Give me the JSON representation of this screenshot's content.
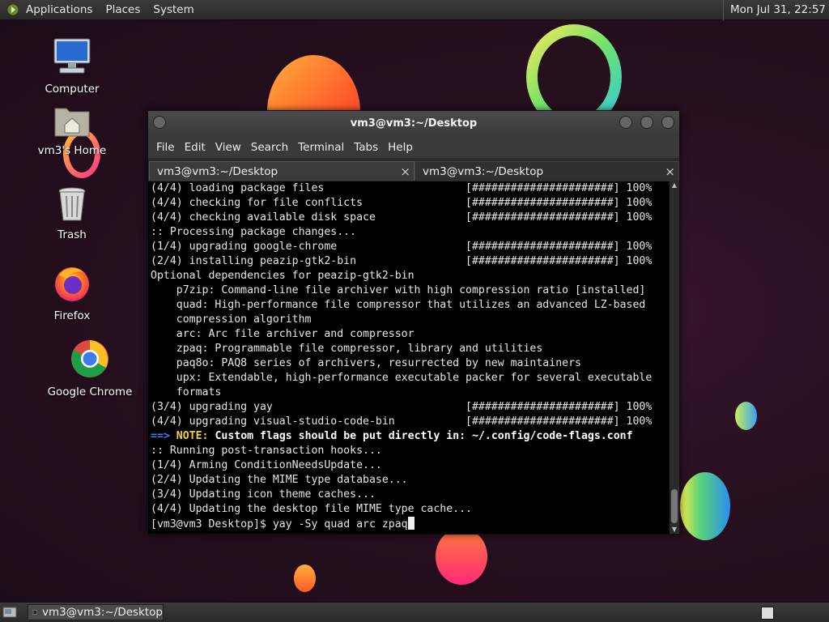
{
  "top_panel": {
    "menus": [
      "Applications",
      "Places",
      "System"
    ],
    "clock": "Mon Jul 31, 22:57"
  },
  "desktop_icons": [
    {
      "label": "Computer",
      "icon": "computer-icon"
    },
    {
      "label": "vm3's Home",
      "icon": "home-folder-icon"
    },
    {
      "label": "Trash",
      "icon": "trash-icon"
    },
    {
      "label": "Firefox",
      "icon": "firefox-icon"
    },
    {
      "label": "Google Chrome",
      "icon": "chrome-icon"
    }
  ],
  "window": {
    "title": "vm3@vm3:~/Desktop",
    "menu": [
      "File",
      "Edit",
      "View",
      "Search",
      "Terminal",
      "Tabs",
      "Help"
    ],
    "tabs": [
      {
        "label": "vm3@vm3:~/Desktop",
        "close": "×"
      },
      {
        "label": "vm3@vm3:~/Desktop",
        "close": "×"
      }
    ]
  },
  "terminal": {
    "lines": [
      "(4/4) loading package files                      [######################] 100%",
      "(4/4) checking for file conflicts                [######################] 100%",
      "(4/4) checking available disk space              [######################] 100%",
      ":: Processing package changes...",
      "(1/4) upgrading google-chrome                    [######################] 100%",
      "(2/4) installing peazip-gtk2-bin                 [######################] 100%",
      "Optional dependencies for peazip-gtk2-bin",
      "    p7zip: Command-line file archiver with high compression ratio [installed]",
      "    quad: High-performance file compressor that utilizes an advanced LZ-based",
      "    compression algorithm",
      "    arc: Arc file archiver and compressor",
      "    zpaq: Programmable file compressor, library and utilities",
      "    paq8o: PAQ8 series of archivers, resurrected by new maintainers",
      "    upx: Extendable, high-performance executable packer for several executable",
      "    formats",
      "(3/4) upgrading yay                              [######################] 100%",
      "(4/4) upgrading visual-studio-code-bin           [######################] 100%"
    ],
    "note_arrow": "==>",
    "note_label": "NOTE:",
    "note_text": "Custom flags should be put directly in: ~/.config/code-flags.conf",
    "lines_after": [
      ":: Running post-transaction hooks...",
      "(1/4) Arming ConditionNeedsUpdate...",
      "(2/4) Updating the MIME type database...",
      "(3/4) Updating icon theme caches...",
      "(4/4) Updating the desktop file MIME type cache..."
    ],
    "prompt": "[vm3@vm3 Desktop]$ ",
    "command": "yay -Sy quad arc zpaq"
  },
  "taskbar": {
    "task_label": "vm3@vm3:~/Desktop"
  }
}
